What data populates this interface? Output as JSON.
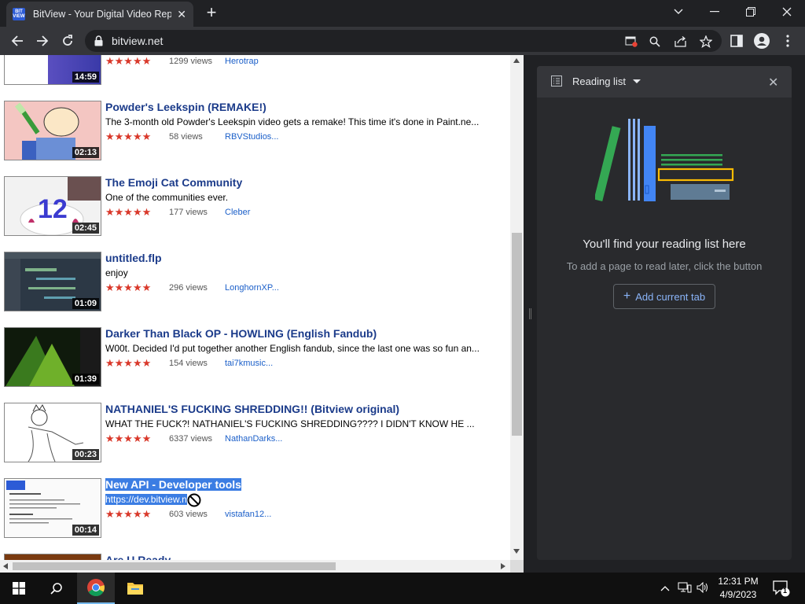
{
  "browser": {
    "tab_title": "BitView - Your Digital Video Repo",
    "favicon_text": "BIT VIEW",
    "url": "bitview.net"
  },
  "videos": [
    {
      "title": "",
      "desc": "",
      "stars": "★★★★★",
      "views": "1299 views",
      "author": "Herotrap",
      "duration": "14:59"
    },
    {
      "title": "Powder's Leekspin (REMAKE!)",
      "desc": "The 3-month old Powder's Leekspin video gets a remake! This time it's done in Paint.ne...",
      "stars": "★★★★★",
      "views": "58 views",
      "author": "RBVStudios...",
      "duration": "02:13"
    },
    {
      "title": "The Emoji Cat Community",
      "desc": "One of the communities ever.",
      "stars": "★★★★★",
      "views": "177 views",
      "author": "Cleber",
      "duration": "02:45"
    },
    {
      "title": "untitled.flp",
      "desc": "enjoy",
      "stars": "★★★★★",
      "views": "296 views",
      "author": "LonghornXP...",
      "duration": "01:09"
    },
    {
      "title": "Darker Than Black OP - HOWLING (English Fandub)",
      "desc": "W00t. Decided I'd put together another English fandub, since the last one was so fun an...",
      "stars": "★★★★★",
      "views": "154 views",
      "author": "tai7kmusic...",
      "duration": "01:39"
    },
    {
      "title": "NATHANIEL'S FUCKING SHREDDING!! (Bitview original)",
      "desc": "WHAT THE FUCK?! NATHANIEL'S FUCKING SHREDDING???? I DIDN'T KNOW HE ...",
      "stars": "★★★★★",
      "views": "6337 views",
      "author": "NathanDarks...",
      "duration": "00:23"
    },
    {
      "title": "New API - Developer tools",
      "desc": "https://dev.bitview.n",
      "stars": "★★★★★",
      "views": "603 views",
      "author": "vistafan12...",
      "duration": "00:14"
    },
    {
      "title": "Are U Ready",
      "desc": "",
      "stars": "",
      "views": "",
      "author": "",
      "duration": ""
    }
  ],
  "reading_list": {
    "title": "Reading list",
    "empty_title": "You'll find your reading list here",
    "empty_subtitle": "To add a page to read later, click the button",
    "add_button": "Add current tab"
  },
  "taskbar": {
    "time": "12:31 PM",
    "date": "4/9/2023",
    "notification_count": "1"
  }
}
